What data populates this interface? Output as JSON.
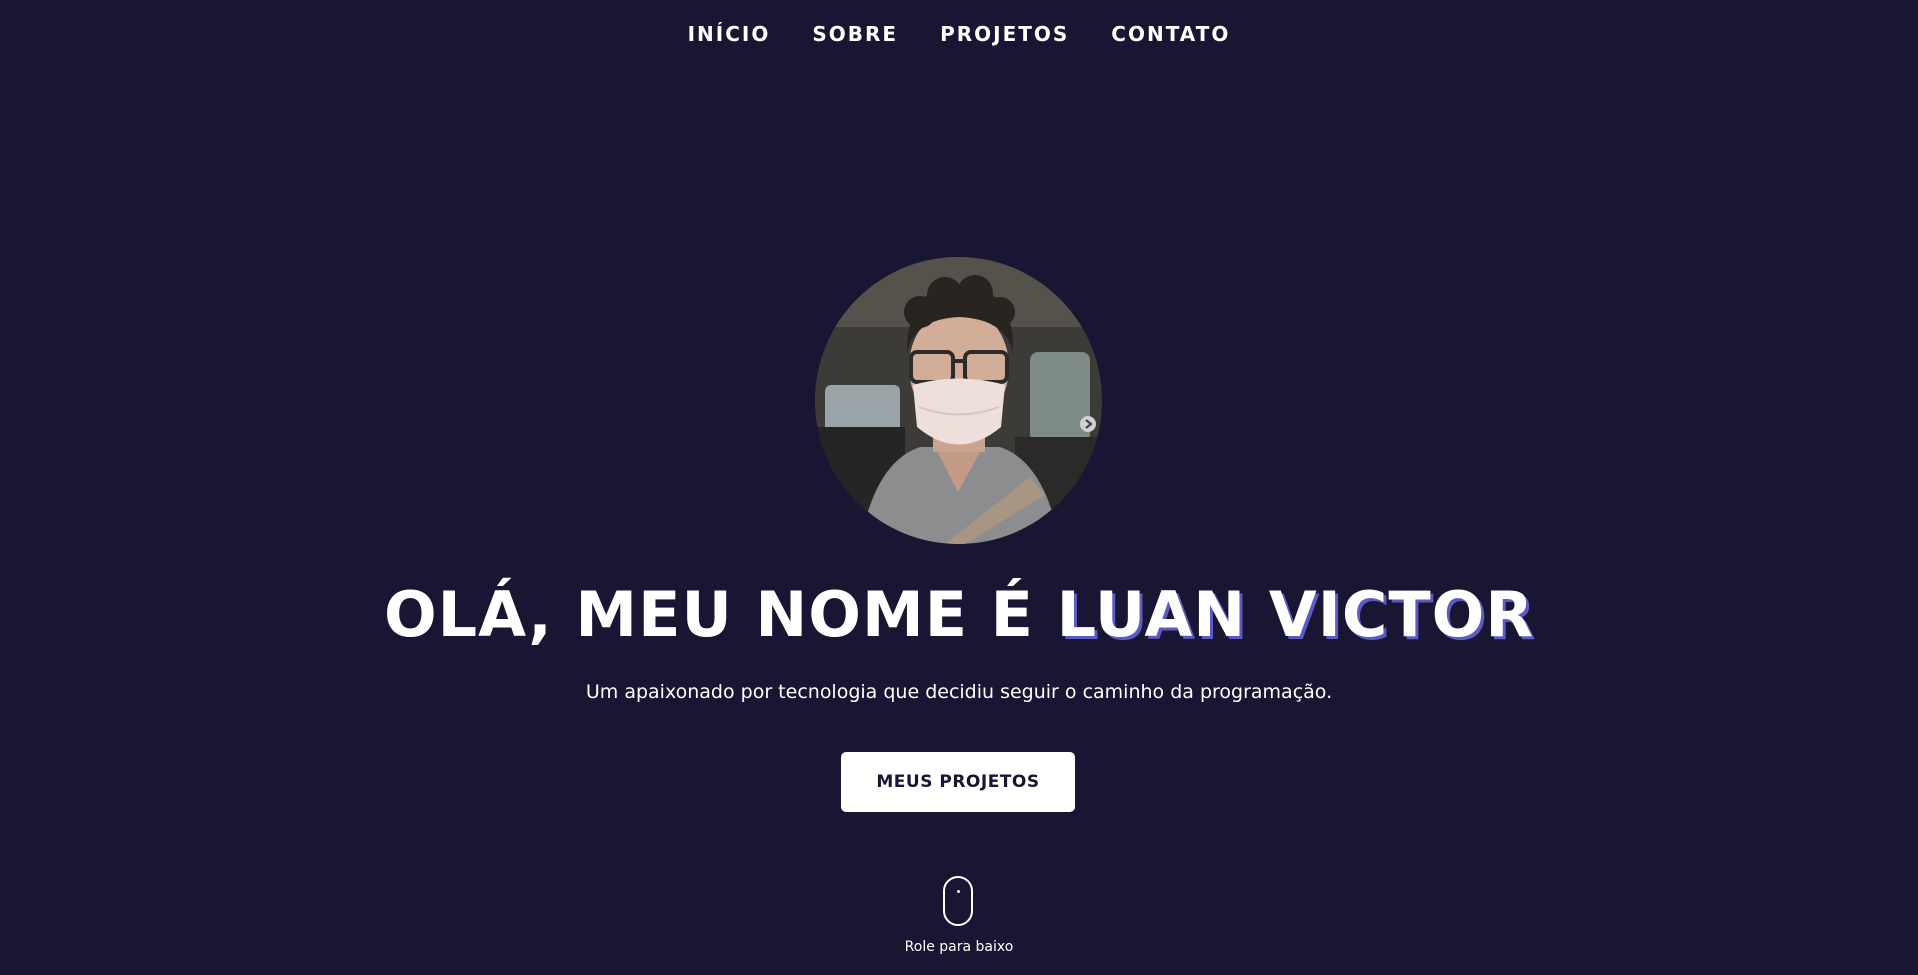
{
  "nav": {
    "items": [
      {
        "label": "INÍCIO"
      },
      {
        "label": "SOBRE"
      },
      {
        "label": "PROJETOS"
      },
      {
        "label": "CONTATO"
      }
    ]
  },
  "hero": {
    "greeting": "OLÁ, MEU NOME É",
    "name": "LUAN VICTOR",
    "subtitle": "Um apaixonado por tecnologia que decidiu seguir o caminho da programação.",
    "cta_label": "MEUS PROJETOS",
    "avatar_icon": "profile-photo"
  },
  "scroll_hint": {
    "label": "Role para baixo",
    "icon": "mouse-icon"
  },
  "colors": {
    "background": "#181632",
    "text": "#ffffff",
    "name_shadow": "#5a5cc4",
    "button_bg": "#ffffff",
    "button_text": "#181632"
  }
}
